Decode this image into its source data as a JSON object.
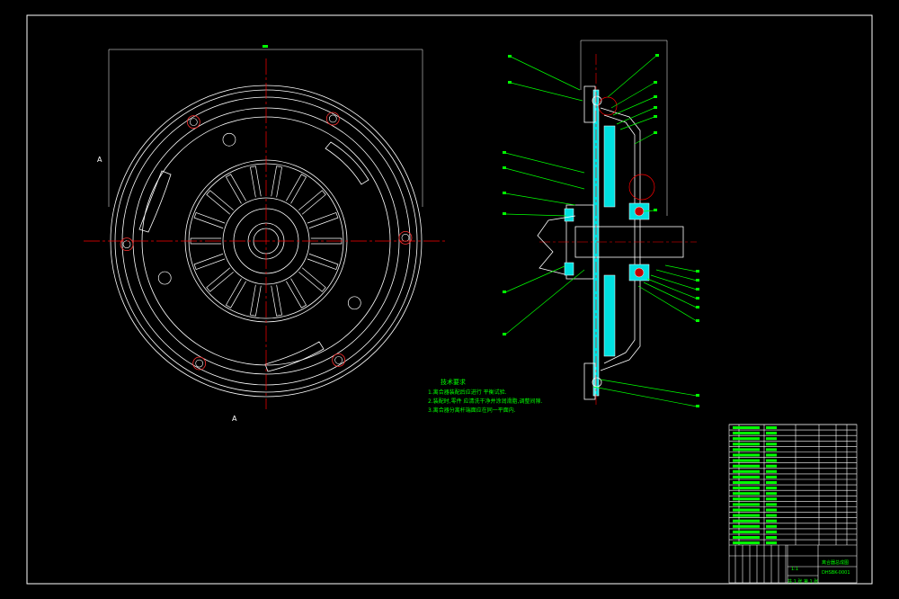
{
  "technical_requirements": {
    "title": "技术要求",
    "lines": [
      "1.离合器装配后应进行 平衡试验.",
      "2.装配时,零件 应清洗干净并涂润滑脂,调整间隙.",
      "3.离合器分离杆端面应在同一平面内."
    ]
  },
  "title_block": {
    "drawing_name": "离合器总成图",
    "drawing_number": "DHSBK-0001",
    "scale": "1:1",
    "sheet": "共 1 张  第 1 张"
  },
  "colors": {
    "background": "#000000",
    "outline": "#ffffff",
    "centerline": "#ff0000",
    "leader": "#00ff00",
    "section_fill": "#00e0e0",
    "border": "#ffffff"
  }
}
